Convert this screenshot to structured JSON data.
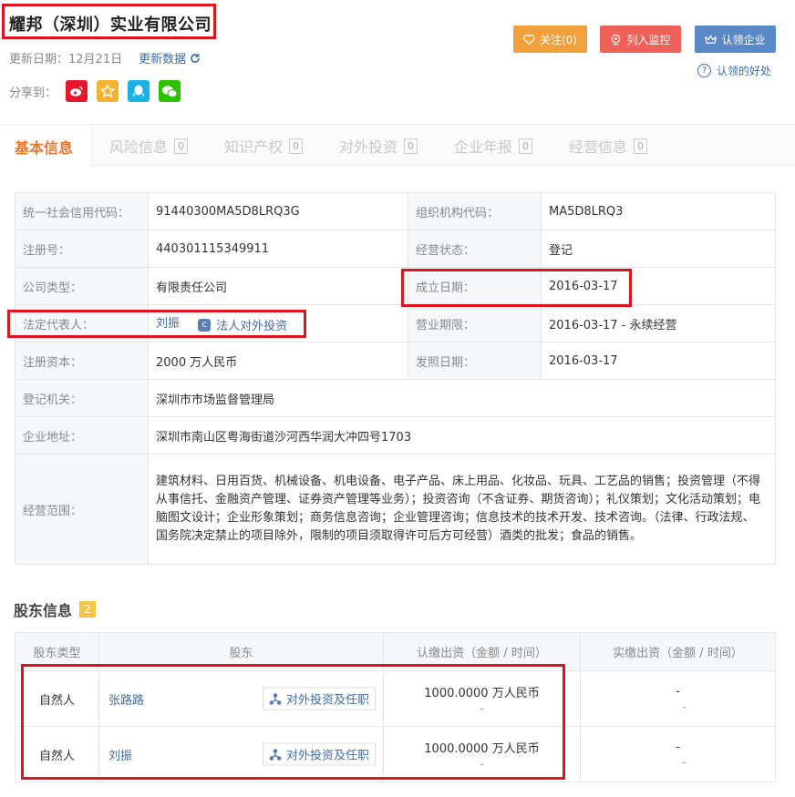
{
  "header": {
    "company_name": "耀邦（深圳）实业有限公司",
    "update_label": "更新日期：12月21日",
    "refresh_label": "更新数据",
    "share_label": "分享到：",
    "share_icons": [
      "weibo-icon",
      "qzone-icon",
      "qq-icon",
      "wechat-icon"
    ]
  },
  "actions": {
    "follow_label": "关注(0)",
    "monitor_label": "列入监控",
    "claim_label": "认领企业",
    "claim_help_label": "认领的好处"
  },
  "tabs": [
    {
      "label": "基本信息",
      "count": null,
      "active": true
    },
    {
      "label": "风险信息",
      "count": "0",
      "active": false
    },
    {
      "label": "知识产权",
      "count": "0",
      "active": false
    },
    {
      "label": "对外投资",
      "count": "0",
      "active": false
    },
    {
      "label": "企业年报",
      "count": "0",
      "active": false
    },
    {
      "label": "经营信息",
      "count": "0",
      "active": false
    }
  ],
  "info": {
    "credit_code_label": "统一社会信用代码：",
    "credit_code": "91440300MA5D8LRQ3G",
    "org_code_label": "组织机构代码：",
    "org_code": "MA5D8LRQ3",
    "reg_no_label": "注册号：",
    "reg_no": "440301115349911",
    "status_label": "经营状态：",
    "status": "登记",
    "type_label": "公司类型：",
    "type": "有限责任公司",
    "found_date_label": "成立日期：",
    "found_date": "2016-03-17",
    "legal_rep_label": "法定代表人：",
    "legal_rep": "刘振",
    "legal_invest_label": "法人对外投资",
    "term_label": "营业期限：",
    "term": "2016-03-17 - 永续经营",
    "capital_label": "注册资本：",
    "capital": "2000 万人民币",
    "issue_date_label": "发照日期：",
    "issue_date": "2016-03-17",
    "authority_label": "登记机关：",
    "authority": "深圳市市场监督管理局",
    "address_label": "企业地址：",
    "address": "深圳市南山区粤海街道沙河西华润大冲四号1703",
    "scope_label": "经营范围：",
    "scope": "建筑材料、日用百货、机械设备、机电设备、电子产品、床上用品、化妆品、玩具、工艺品的销售；投资管理（不得从事信托、金融资产管理、证券资产管理等业务）；投资咨询（不含证券、期货咨询）；礼仪策划；文化活动策划；电脑图文设计；企业形象策划；商务信息咨询；企业管理咨询；信息技术的技术开发、技术咨询。（法律、行政法规、国务院决定禁止的项目除外，限制的项目须取得许可后方可经营）酒类的批发；食品的销售。"
  },
  "shareholders": {
    "title": "股东信息",
    "count": "2",
    "headers": [
      "股东类型",
      "股东",
      "认缴出资（金额 / 时间）",
      "实缴出资（金额 / 时间）"
    ],
    "invest_button_label": "对外投资及任职",
    "rows": [
      {
        "type": "自然人",
        "name": "张路路",
        "subscribed": "1000.0000 万人民币",
        "subscribed_time": "-",
        "paid": "-",
        "paid_time": "-"
      },
      {
        "type": "自然人",
        "name": "刘振",
        "subscribed": "1000.0000 万人民币",
        "subscribed_time": "-",
        "paid": "-",
        "paid_time": "-"
      }
    ]
  },
  "colors": {
    "follow": "#f2a03c",
    "monitor": "#ef6158",
    "claim": "#5a89c8",
    "highlight": "#e0141e",
    "active_tab": "#e8772e"
  }
}
